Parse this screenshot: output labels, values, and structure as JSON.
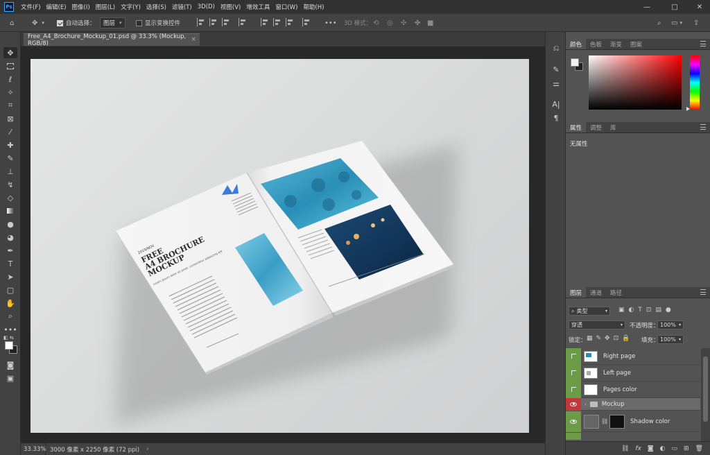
{
  "app": {
    "logo": "Ps"
  },
  "menu": [
    "文件(F)",
    "编辑(E)",
    "图像(I)",
    "图层(L)",
    "文字(Y)",
    "选择(S)",
    "滤镜(T)",
    "3D(D)",
    "视图(V)",
    "增效工具",
    "窗口(W)",
    "帮助(H)"
  ],
  "window_controls": {
    "minimize": "—",
    "maximize": "□",
    "close": "✕"
  },
  "options": {
    "auto_select_label": "自动选择：",
    "auto_select_target": "图层",
    "show_transform_label": "显示变换控件",
    "mode_3d_label": "3D 模式："
  },
  "document": {
    "tab_title": "Free_A4_Brochure_Mockup_01.psd @ 33.3% (Mockup, RGB/8)",
    "close": "×"
  },
  "brochure": {
    "date": "2019/NOV",
    "headline": [
      "FREE",
      "A4 BROCHURE",
      "MOCKUP"
    ],
    "intro": "Lorem ipsum dolor sit amet, consectetur adipiscing elit"
  },
  "status": {
    "zoom": "33.33%",
    "dimensions": "3000 像素 x 2250 像素 (72 ppi)",
    "arrow": "›"
  },
  "panels": {
    "color_tabs": [
      "颜色",
      "色板",
      "渐变",
      "图案"
    ],
    "properties_tabs": [
      "属性",
      "调整",
      "库"
    ],
    "properties_empty": "无属性",
    "layers_tabs": [
      "图层",
      "通道",
      "路径"
    ],
    "filter_kind": "类型",
    "blend_mode": "穿透",
    "opacity_label": "不透明度：",
    "opacity_value": "100%",
    "lock_label": "锁定：",
    "fill_label": "填充：",
    "fill_value": "100%"
  },
  "layers": [
    {
      "name": "Right page",
      "visibility": "green"
    },
    {
      "name": "Left page",
      "visibility": "green"
    },
    {
      "name": "Pages color",
      "visibility": "green"
    },
    {
      "name": "Mockup",
      "visibility": "red",
      "group": true,
      "selected": true
    },
    {
      "name": "Shadow color",
      "visibility": "green"
    }
  ],
  "layer_footer_icons": [
    "link-icon",
    "fx-icon",
    "mask-icon",
    "adjustment-icon",
    "folder-icon",
    "new-layer-icon",
    "trash-icon"
  ],
  "colors": {
    "ui_dark": "#323232",
    "panel": "#535353",
    "visibility_green": "#6b9c45",
    "visibility_red": "#c0393a",
    "accent_blue": "#31a8ff"
  }
}
